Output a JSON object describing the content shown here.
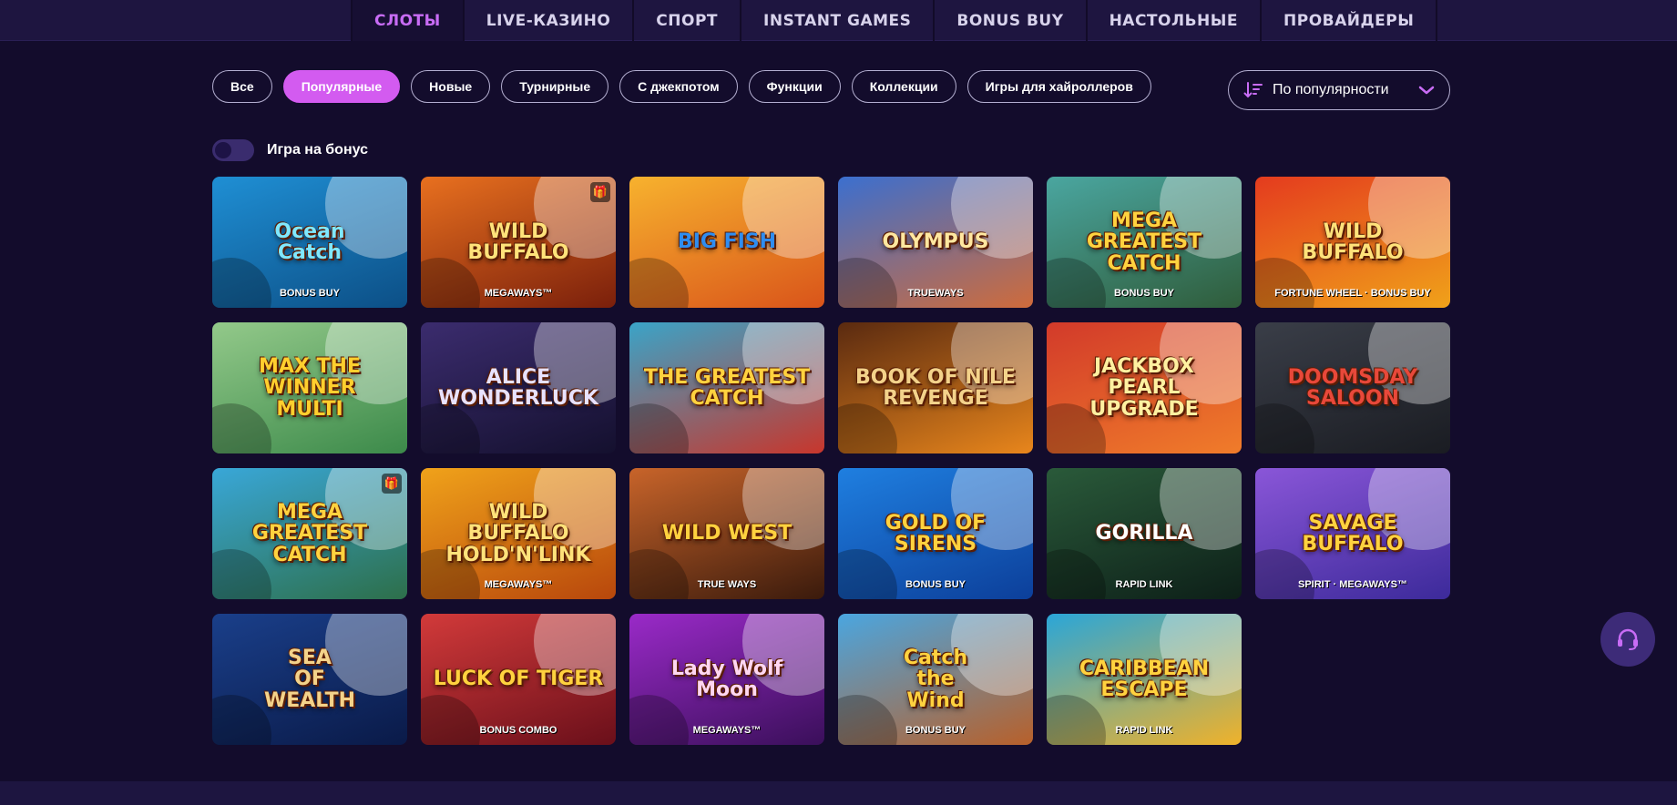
{
  "nav": {
    "tabs": [
      {
        "label": "СЛОТЫ",
        "active": true
      },
      {
        "label": "LIVE-КАЗИНО",
        "active": false
      },
      {
        "label": "СПОРТ",
        "active": false
      },
      {
        "label": "INSTANT GAMES",
        "active": false
      },
      {
        "label": "BONUS BUY",
        "active": false
      },
      {
        "label": "НАСТОЛЬНЫЕ",
        "active": false
      },
      {
        "label": "ПРОВАЙДЕРЫ",
        "active": false
      }
    ]
  },
  "filters": [
    {
      "label": "Все"
    },
    {
      "label": "Популярные",
      "active": true
    },
    {
      "label": "Новые"
    },
    {
      "label": "Турнирные"
    },
    {
      "label": "С джекпотом"
    },
    {
      "label": "Функции"
    },
    {
      "label": "Коллекции"
    },
    {
      "label": "Игры для хайроллеров"
    }
  ],
  "sort": {
    "label": "По популярности",
    "icon": "sort-descending-icon"
  },
  "bonus_toggle": {
    "label": "Игра на бонус",
    "on": false
  },
  "games": [
    {
      "title": "Ocean\nCatch",
      "sub": "BONUS BUY",
      "bg": [
        "#1f8fd4",
        "#0c4f86"
      ],
      "fg": "#7fe8ff",
      "gift": false
    },
    {
      "title": "WILD\nBUFFALO",
      "sub": "MEGAWAYS™",
      "bg": [
        "#e8701f",
        "#7a1f0b"
      ],
      "fg": "#ffe27a",
      "gift": true
    },
    {
      "title": "BIG FISH",
      "sub": "",
      "bg": [
        "#f7b22e",
        "#d9541a"
      ],
      "fg": "#2f8df0",
      "gift": false
    },
    {
      "title": "OLYMPUS",
      "sub": "TRUEWAYS",
      "bg": [
        "#3b6fcf",
        "#cf6b3b"
      ],
      "fg": "#ffe7a0",
      "gift": false
    },
    {
      "title": "MEGA\nGREATEST\nCATCH",
      "sub": "BONUS BUY",
      "bg": [
        "#4aa6a0",
        "#2f5c3a"
      ],
      "fg": "#ffd23f",
      "gift": false
    },
    {
      "title": "WILD\nBUFFALO",
      "sub": "FORTUNE WHEEL · BONUS BUY",
      "bg": [
        "#e43b1e",
        "#f0a21a"
      ],
      "fg": "#ffe27a",
      "gift": false
    },
    {
      "title": "MAX THE WINNER\nMULTI",
      "sub": "",
      "bg": [
        "#93c98a",
        "#3c8a4a"
      ],
      "fg": "#ffcf2e",
      "gift": false
    },
    {
      "title": "ALICE\nWONDERLUCK",
      "sub": "",
      "bg": [
        "#3b2c6e",
        "#14102e"
      ],
      "fg": "#e8e2ff",
      "gift": false
    },
    {
      "title": "THE GREATEST\nCATCH",
      "sub": "",
      "bg": [
        "#3aa4c8",
        "#c8362c"
      ],
      "fg": "#ffd23f",
      "gift": false
    },
    {
      "title": "BOOK OF NILE\nREVENGE",
      "sub": "",
      "bg": [
        "#5a2a10",
        "#e8861c"
      ],
      "fg": "#f3d28a",
      "gift": false
    },
    {
      "title": "JACKBOX\nPEARL\nUPGRADE",
      "sub": "",
      "bg": [
        "#d23a2a",
        "#f07c2a"
      ],
      "fg": "#fff0a0",
      "gift": false
    },
    {
      "title": "DOOMSDAY\nSALOON",
      "sub": "",
      "bg": [
        "#3a3e48",
        "#1a1c22"
      ],
      "fg": "#e8483a",
      "gift": false
    },
    {
      "title": "MEGA\nGREATEST\nCATCH",
      "sub": "",
      "bg": [
        "#39a7d8",
        "#2d6f4a"
      ],
      "fg": "#ffd23f",
      "gift": true
    },
    {
      "title": "WILD\nBUFFALO\nHOLD'N'LINK",
      "sub": "MEGAWAYS™",
      "bg": [
        "#f0a21a",
        "#b8470c"
      ],
      "fg": "#ffe27a",
      "gift": false
    },
    {
      "title": "WILD WEST",
      "sub": "TRUE WAYS",
      "bg": [
        "#c8642a",
        "#3a1a0c"
      ],
      "fg": "#ffd23f",
      "gift": false
    },
    {
      "title": "GOLD OF\nSIRENS",
      "sub": "BONUS BUY",
      "bg": [
        "#1f7fe0",
        "#0c3f9a"
      ],
      "fg": "#ffd23f",
      "gift": false
    },
    {
      "title": "GORILLA",
      "sub": "RAPID LINK",
      "bg": [
        "#2a5a3a",
        "#0d1f18"
      ],
      "fg": "#ffffff",
      "gift": false
    },
    {
      "title": "SAVAGE BUFFALO",
      "sub": "SPIRIT · MEGAWAYS™",
      "bg": [
        "#8a56d8",
        "#3c2a9a"
      ],
      "fg": "#ffd23f",
      "gift": false
    },
    {
      "title": "SEA\nOF\nWEALTH",
      "sub": "",
      "bg": [
        "#1a3f8a",
        "#0a1a48"
      ],
      "fg": "#f3d28a",
      "gift": false
    },
    {
      "title": "LUCK OF TIGER",
      "sub": "BONUS COMBO",
      "bg": [
        "#d23a3a",
        "#6a0f1a"
      ],
      "fg": "#ffd23f",
      "gift": false
    },
    {
      "title": "Lady Wolf Moon",
      "sub": "MEGAWAYS™",
      "bg": [
        "#9a2ac8",
        "#3a0f5a"
      ],
      "fg": "#ffd6f2",
      "gift": false
    },
    {
      "title": "Catch\nthe\nWind",
      "sub": "BONUS BUY",
      "bg": [
        "#4aa6e0",
        "#b8602a"
      ],
      "fg": "#ffd23f",
      "gift": false
    },
    {
      "title": "CARIBBEAN\nESCAPE",
      "sub": "RAPID LINK",
      "bg": [
        "#2aa6d8",
        "#f0b22a"
      ],
      "fg": "#ffd23f",
      "gift": false
    }
  ],
  "support": {
    "icon": "headset-icon"
  }
}
